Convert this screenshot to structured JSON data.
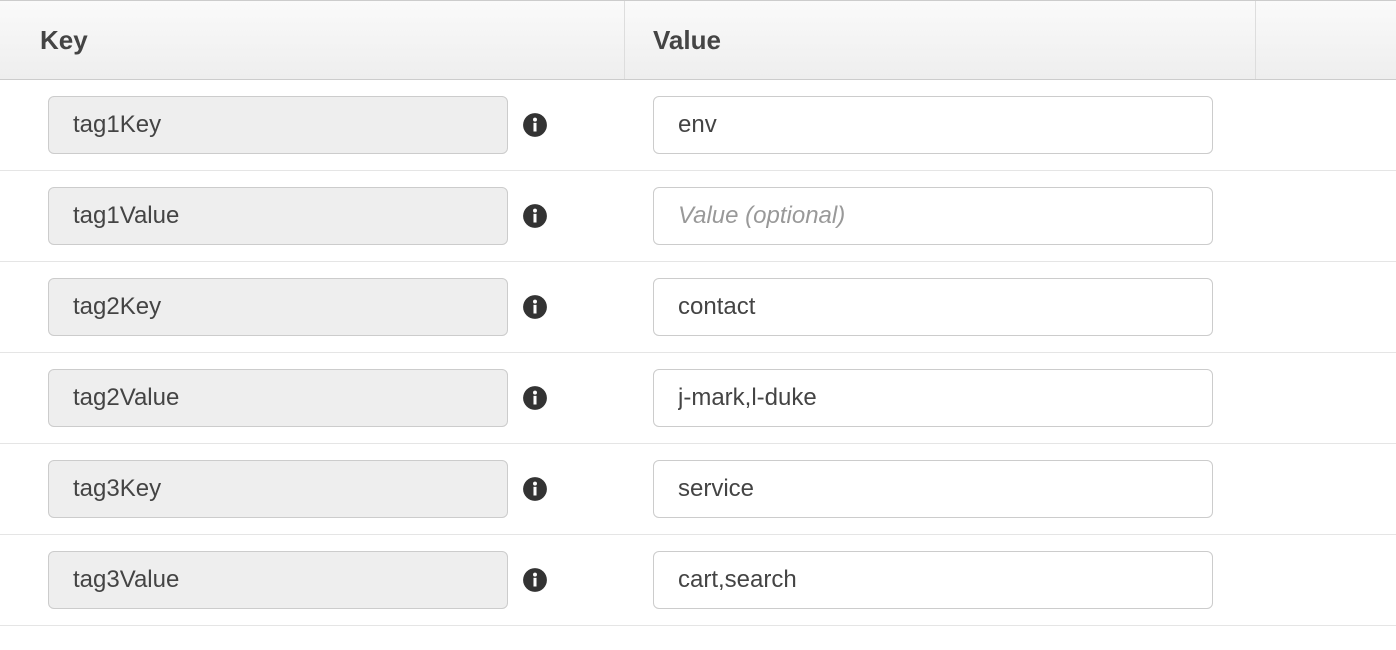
{
  "headers": {
    "key": "Key",
    "value": "Value"
  },
  "rows": [
    {
      "key": "tag1Key",
      "value": "env",
      "placeholder": "Value (optional)"
    },
    {
      "key": "tag1Value",
      "value": "",
      "placeholder": "Value (optional)"
    },
    {
      "key": "tag2Key",
      "value": "contact",
      "placeholder": "Value (optional)"
    },
    {
      "key": "tag2Value",
      "value": "j-mark,l-duke",
      "placeholder": "Value (optional)"
    },
    {
      "key": "tag3Key",
      "value": "service",
      "placeholder": "Value (optional)"
    },
    {
      "key": "tag3Value",
      "value": "cart,search",
      "placeholder": "Value (optional)"
    }
  ]
}
